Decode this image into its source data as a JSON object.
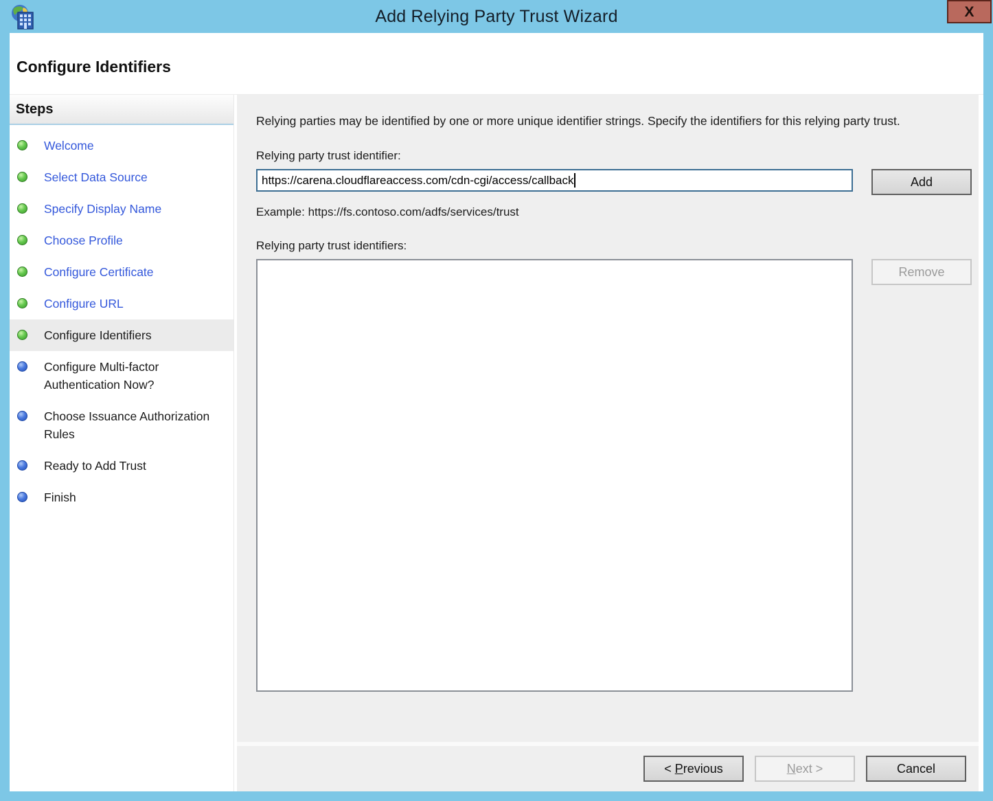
{
  "window": {
    "title": "Add Relying Party Trust Wizard",
    "close_glyph": "X"
  },
  "header": {
    "title": "Configure Identifiers"
  },
  "sidebar": {
    "heading": "Steps",
    "items": [
      {
        "label": "Welcome",
        "state": "done"
      },
      {
        "label": "Select Data Source",
        "state": "done"
      },
      {
        "label": "Specify Display Name",
        "state": "done"
      },
      {
        "label": "Choose Profile",
        "state": "done"
      },
      {
        "label": "Configure Certificate",
        "state": "done"
      },
      {
        "label": "Configure URL",
        "state": "done"
      },
      {
        "label": "Configure Identifiers",
        "state": "current"
      },
      {
        "label": "Configure Multi-factor Authentication Now?",
        "state": "upcoming"
      },
      {
        "label": "Choose Issuance Authorization Rules",
        "state": "upcoming"
      },
      {
        "label": "Ready to Add Trust",
        "state": "upcoming"
      },
      {
        "label": "Finish",
        "state": "upcoming"
      }
    ]
  },
  "main": {
    "description": "Relying parties may be identified by one or more unique identifier strings. Specify the identifiers for this relying party trust.",
    "identifier_label": "Relying party trust identifier:",
    "identifier_value": "https://carena.cloudflareaccess.com/cdn-cgi/access/callback",
    "add_button": "Add",
    "example": "Example: https://fs.contoso.com/adfs/services/trust",
    "identifiers_list_label": "Relying party trust identifiers:",
    "identifiers": [],
    "remove_button": "Remove"
  },
  "footer": {
    "previous_pre": "< ",
    "previous_key": "P",
    "previous_rest": "revious",
    "next_key": "N",
    "next_rest": "ext >",
    "cancel_button": "Cancel"
  },
  "colors": {
    "titlebar_blue": "#7dc7e6",
    "close_button_red": "#b9695d",
    "step_link_blue": "#3458db",
    "done_dot_green": "#3a9a2b",
    "upcoming_dot_blue": "#2451b6",
    "focused_input_border": "#3c6e93",
    "content_background": "#efefef",
    "current_step_highlight": "#ebebeb"
  }
}
